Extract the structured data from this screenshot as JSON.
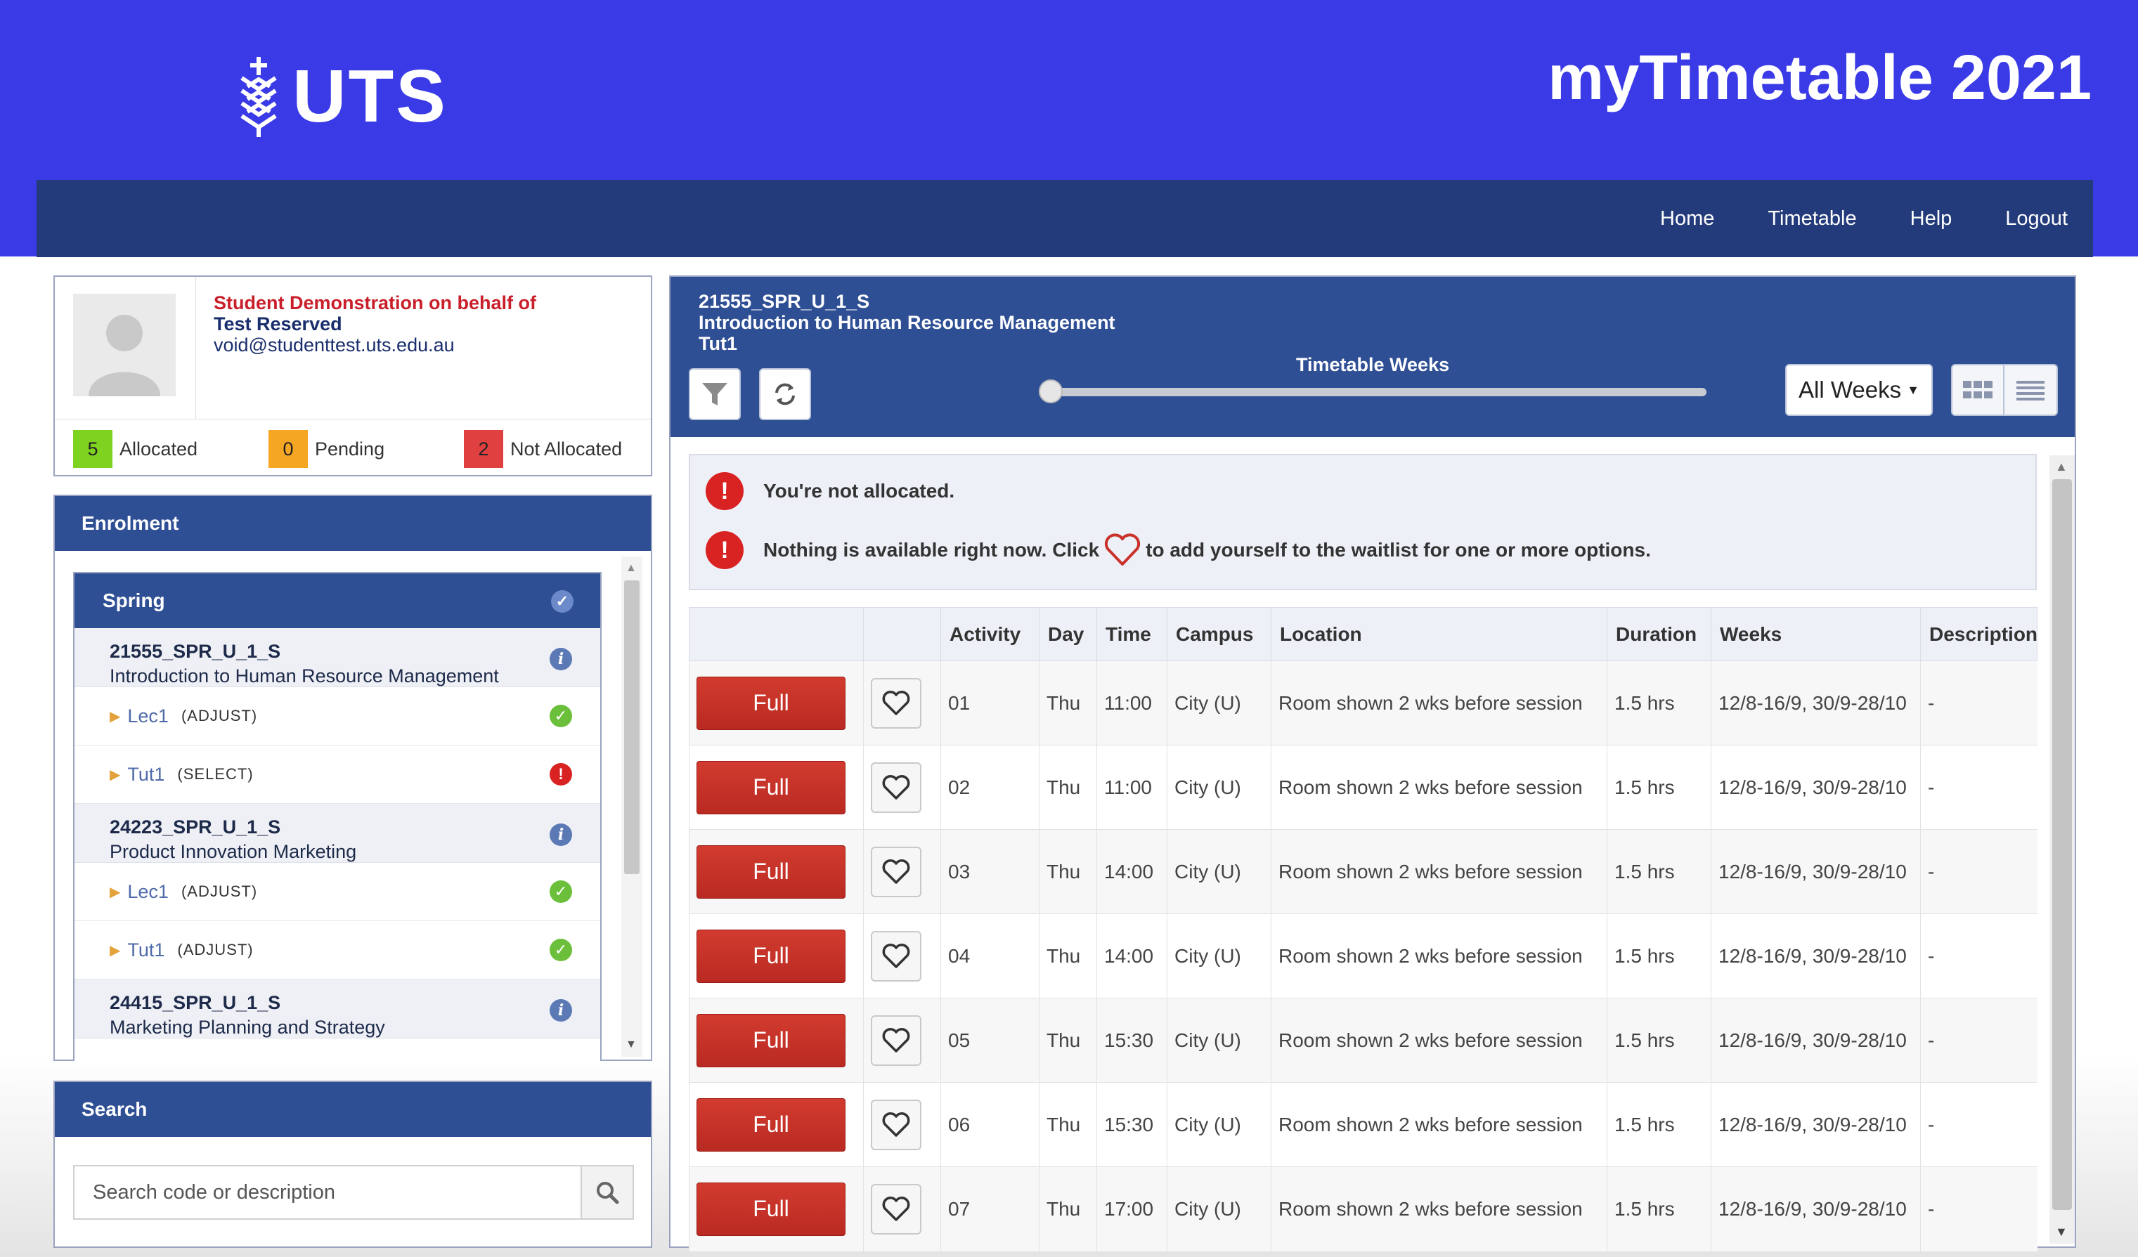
{
  "header": {
    "logo_text": "UTS",
    "app_title": "myTimetable 2021",
    "nav": [
      "Home",
      "Timetable",
      "Help",
      "Logout"
    ]
  },
  "user": {
    "line1": "Student Demonstration on behalf of",
    "line2": "Test Reserved",
    "email": "void@studenttest.uts.edu.au",
    "stats": [
      {
        "count": "5",
        "label": "Allocated",
        "color": "#7ed321"
      },
      {
        "count": "0",
        "label": "Pending",
        "color": "#f5a623"
      },
      {
        "count": "2",
        "label": "Not Allocated",
        "color": "#e04040"
      }
    ]
  },
  "enrolment": {
    "title": "Enrolment",
    "semester": "Spring",
    "courses": [
      {
        "code": "21555_SPR_U_1_S",
        "name": "Introduction to Human Resource Management",
        "activities": [
          {
            "name": "Lec1",
            "state": "(ADJUST)",
            "status": "ok"
          },
          {
            "name": "Tut1",
            "state": "(SELECT)",
            "status": "error"
          }
        ]
      },
      {
        "code": "24223_SPR_U_1_S",
        "name": "Product Innovation Marketing",
        "activities": [
          {
            "name": "Lec1",
            "state": "(ADJUST)",
            "status": "ok"
          },
          {
            "name": "Tut1",
            "state": "(ADJUST)",
            "status": "ok"
          }
        ]
      },
      {
        "code": "24415_SPR_U_1_S",
        "name": "Marketing Planning and Strategy",
        "activities": []
      }
    ]
  },
  "search": {
    "title": "Search",
    "placeholder": "Search code or description"
  },
  "detail": {
    "code": "21555_SPR_U_1_S",
    "name": "Introduction to Human Resource Management",
    "activity": "Tut1",
    "weeks_label": "Timetable Weeks",
    "weeks_select": "All Weeks",
    "alerts": {
      "not_allocated": "You're not allocated.",
      "nothing_available_before": "Nothing is available right now. Click",
      "nothing_available_after": "to add yourself to the waitlist for one or more options."
    },
    "columns": [
      "",
      "",
      "Activity",
      "Day",
      "Time",
      "Campus",
      "Location",
      "Duration",
      "Weeks",
      "Description"
    ],
    "full_label": "Full",
    "rows": [
      {
        "activity": "01",
        "day": "Thu",
        "time": "11:00",
        "campus": "City (U)",
        "location": "Room shown 2 wks before session",
        "duration": "1.5 hrs",
        "weeks": "12/8-16/9, 30/9-28/10",
        "description": "-"
      },
      {
        "activity": "02",
        "day": "Thu",
        "time": "11:00",
        "campus": "City (U)",
        "location": "Room shown 2 wks before session",
        "duration": "1.5 hrs",
        "weeks": "12/8-16/9, 30/9-28/10",
        "description": "-"
      },
      {
        "activity": "03",
        "day": "Thu",
        "time": "14:00",
        "campus": "City (U)",
        "location": "Room shown 2 wks before session",
        "duration": "1.5 hrs",
        "weeks": "12/8-16/9, 30/9-28/10",
        "description": "-"
      },
      {
        "activity": "04",
        "day": "Thu",
        "time": "14:00",
        "campus": "City (U)",
        "location": "Room shown 2 wks before session",
        "duration": "1.5 hrs",
        "weeks": "12/8-16/9, 30/9-28/10",
        "description": "-"
      },
      {
        "activity": "05",
        "day": "Thu",
        "time": "15:30",
        "campus": "City (U)",
        "location": "Room shown 2 wks before session",
        "duration": "1.5 hrs",
        "weeks": "12/8-16/9, 30/9-28/10",
        "description": "-"
      },
      {
        "activity": "06",
        "day": "Thu",
        "time": "15:30",
        "campus": "City (U)",
        "location": "Room shown 2 wks before session",
        "duration": "1.5 hrs",
        "weeks": "12/8-16/9, 30/9-28/10",
        "description": "-"
      },
      {
        "activity": "07",
        "day": "Thu",
        "time": "17:00",
        "campus": "City (U)",
        "location": "Room shown 2 wks before session",
        "duration": "1.5 hrs",
        "weeks": "12/8-16/9, 30/9-28/10",
        "description": "-"
      }
    ]
  }
}
